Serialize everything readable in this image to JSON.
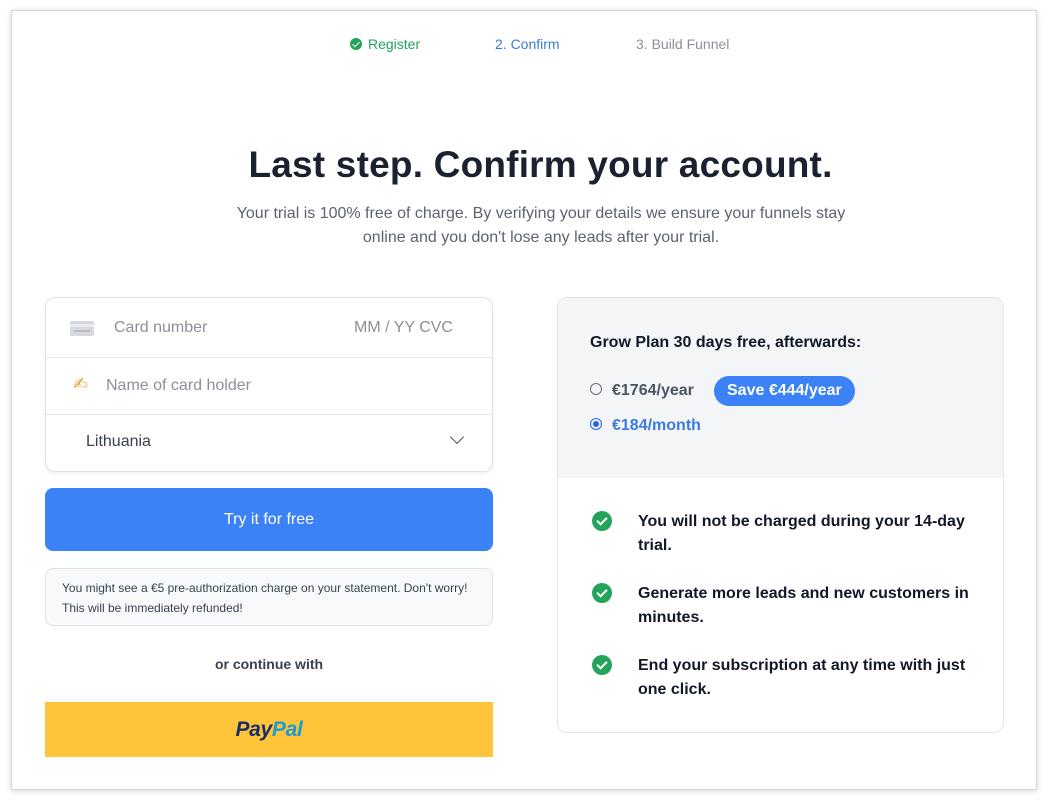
{
  "steps": [
    {
      "label": "Register",
      "state": "done",
      "icon": "check-circle-icon"
    },
    {
      "label": "2. Confirm",
      "state": "active"
    },
    {
      "label": "3. Build Funnel",
      "state": "todo"
    }
  ],
  "header": {
    "title": "Last step. Confirm your account.",
    "subtitle": "Your trial is 100% free of charge. By verifying your details we ensure your funnels stay online and you don't lose any leads after your trial."
  },
  "card_form": {
    "card_number_placeholder": "Card number",
    "expiry_cvc_placeholder": "MM / YY  CVC",
    "holder_placeholder": "Name of card holder",
    "country_value": "Lithuania",
    "icons": {
      "card": "credit-card-icon",
      "holder": "writing-hand-icon",
      "dropdown": "chevron-down-icon"
    }
  },
  "try_button": {
    "label": "Try it for free"
  },
  "note": {
    "text": "You might see a €5 pre-authorization charge on your statement. Don't worry! This will be immediately refunded!"
  },
  "alternative": {
    "or_text": "or continue with",
    "paypal": {
      "part1": "Pay",
      "part2": "Pal"
    }
  },
  "plan": {
    "title": "Grow Plan 30 days free, afterwards:",
    "options": [
      {
        "label": "€1764/year",
        "selected": false
      },
      {
        "label": "€184/month",
        "selected": true
      }
    ],
    "save_badge": "Save €444/year",
    "features": [
      "You will not be charged during your 14-day trial.",
      "Generate more leads and new customers in minutes.",
      "End your subscription at any time with just one click."
    ]
  },
  "colors": {
    "accent_blue": "#3b82f6",
    "success_green": "#22a55b",
    "paypal_yellow": "#ffc439",
    "paypal_navy": "#1a2d6b",
    "paypal_light_blue": "#1c9ad6"
  }
}
